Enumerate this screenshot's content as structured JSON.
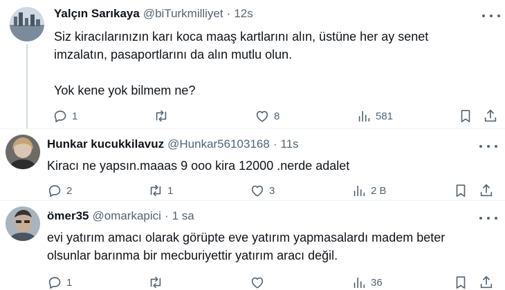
{
  "tweets": [
    {
      "name": "Yalçın Sarıkaya",
      "handle": "@biTurkmilliyet",
      "separator": "·",
      "time": "12s",
      "text": "Siz kiracılarınızın karı koca maaş kartlarını alın, üstüne her ay senet\nimzalatın, pasaportlarını da alın mutlu olun.\n\nYok kene yok bilmem ne?",
      "replies": "1",
      "retweets": "",
      "likes": "8",
      "views": "581"
    },
    {
      "name": "Hunkar kucukkilavuz",
      "handle": "@Hunkar56103168",
      "separator": "·",
      "time": "11s",
      "text": "Kiracı ne yapsın.maaas 9 ooo kira 12000 .nerde adalet",
      "replies": "2",
      "retweets": "1",
      "likes": "3",
      "views": "2 B"
    },
    {
      "name": "ömer35",
      "handle": "@omarkapici",
      "separator": "·",
      "time": "1 sa",
      "text": "evi yatırım amacı olarak görüpte eve yatırım yapmasalardı madem beter\nolsunlar barınma bir mecburiyettir yatırım aracı değil.",
      "replies": "1",
      "retweets": "",
      "likes": "",
      "views": "36"
    }
  ],
  "icons": {
    "reply": "reply-icon",
    "retweet": "retweet-icon",
    "like": "like-icon",
    "views": "views-icon",
    "bookmark": "bookmark-icon",
    "share": "share-icon",
    "more": "more-icon"
  },
  "colors": {
    "text": "#0f1419",
    "secondary": "#536471",
    "divider": "#eff3f4"
  }
}
